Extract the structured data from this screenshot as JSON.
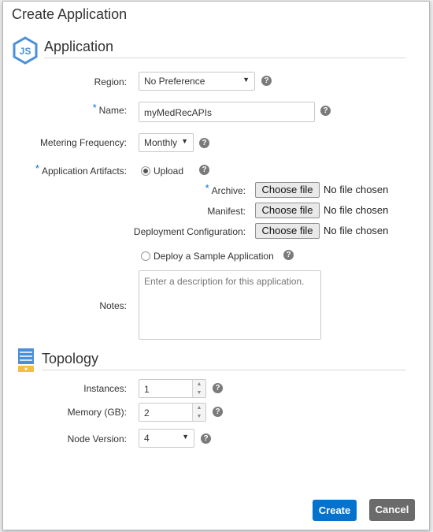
{
  "dialog": {
    "title": "Create Application"
  },
  "application_section": {
    "title": "Application",
    "icon": "nodejs-icon"
  },
  "region": {
    "label": "Region:",
    "value": "No Preference"
  },
  "name": {
    "required_marker": "*",
    "label": "Name:",
    "value": "myMedRecAPIs"
  },
  "metering": {
    "label": "Metering Frequency:",
    "value": "Monthly"
  },
  "artifacts": {
    "required_marker": "*",
    "label": "Application Artifacts:",
    "upload_label": "Upload",
    "upload_selected": true,
    "archive": {
      "required_marker": "*",
      "label": "Archive:",
      "button": "Choose file",
      "status": "No file chosen"
    },
    "manifest": {
      "label": "Manifest:",
      "button": "Choose file",
      "status": "No file chosen"
    },
    "deployment": {
      "label": "Deployment Configuration:",
      "button": "Choose file",
      "status": "No file chosen"
    },
    "sample_label": "Deploy a Sample Application",
    "sample_selected": false
  },
  "notes": {
    "label": "Notes:",
    "placeholder": "Enter a description for this application."
  },
  "topology_section": {
    "title": "Topology",
    "icon": "server-stack-icon"
  },
  "instances": {
    "label": "Instances:",
    "value": "1"
  },
  "memory": {
    "label": "Memory (GB):",
    "value": "2"
  },
  "node_version": {
    "label": "Node Version:",
    "value": "4"
  },
  "help_glyph": "?",
  "footer": {
    "create_label": "Create",
    "cancel_label": "Cancel"
  },
  "colors": {
    "accent": "#0572ce",
    "cancel": "#6b6b6b",
    "help": "#7a7a7a"
  }
}
